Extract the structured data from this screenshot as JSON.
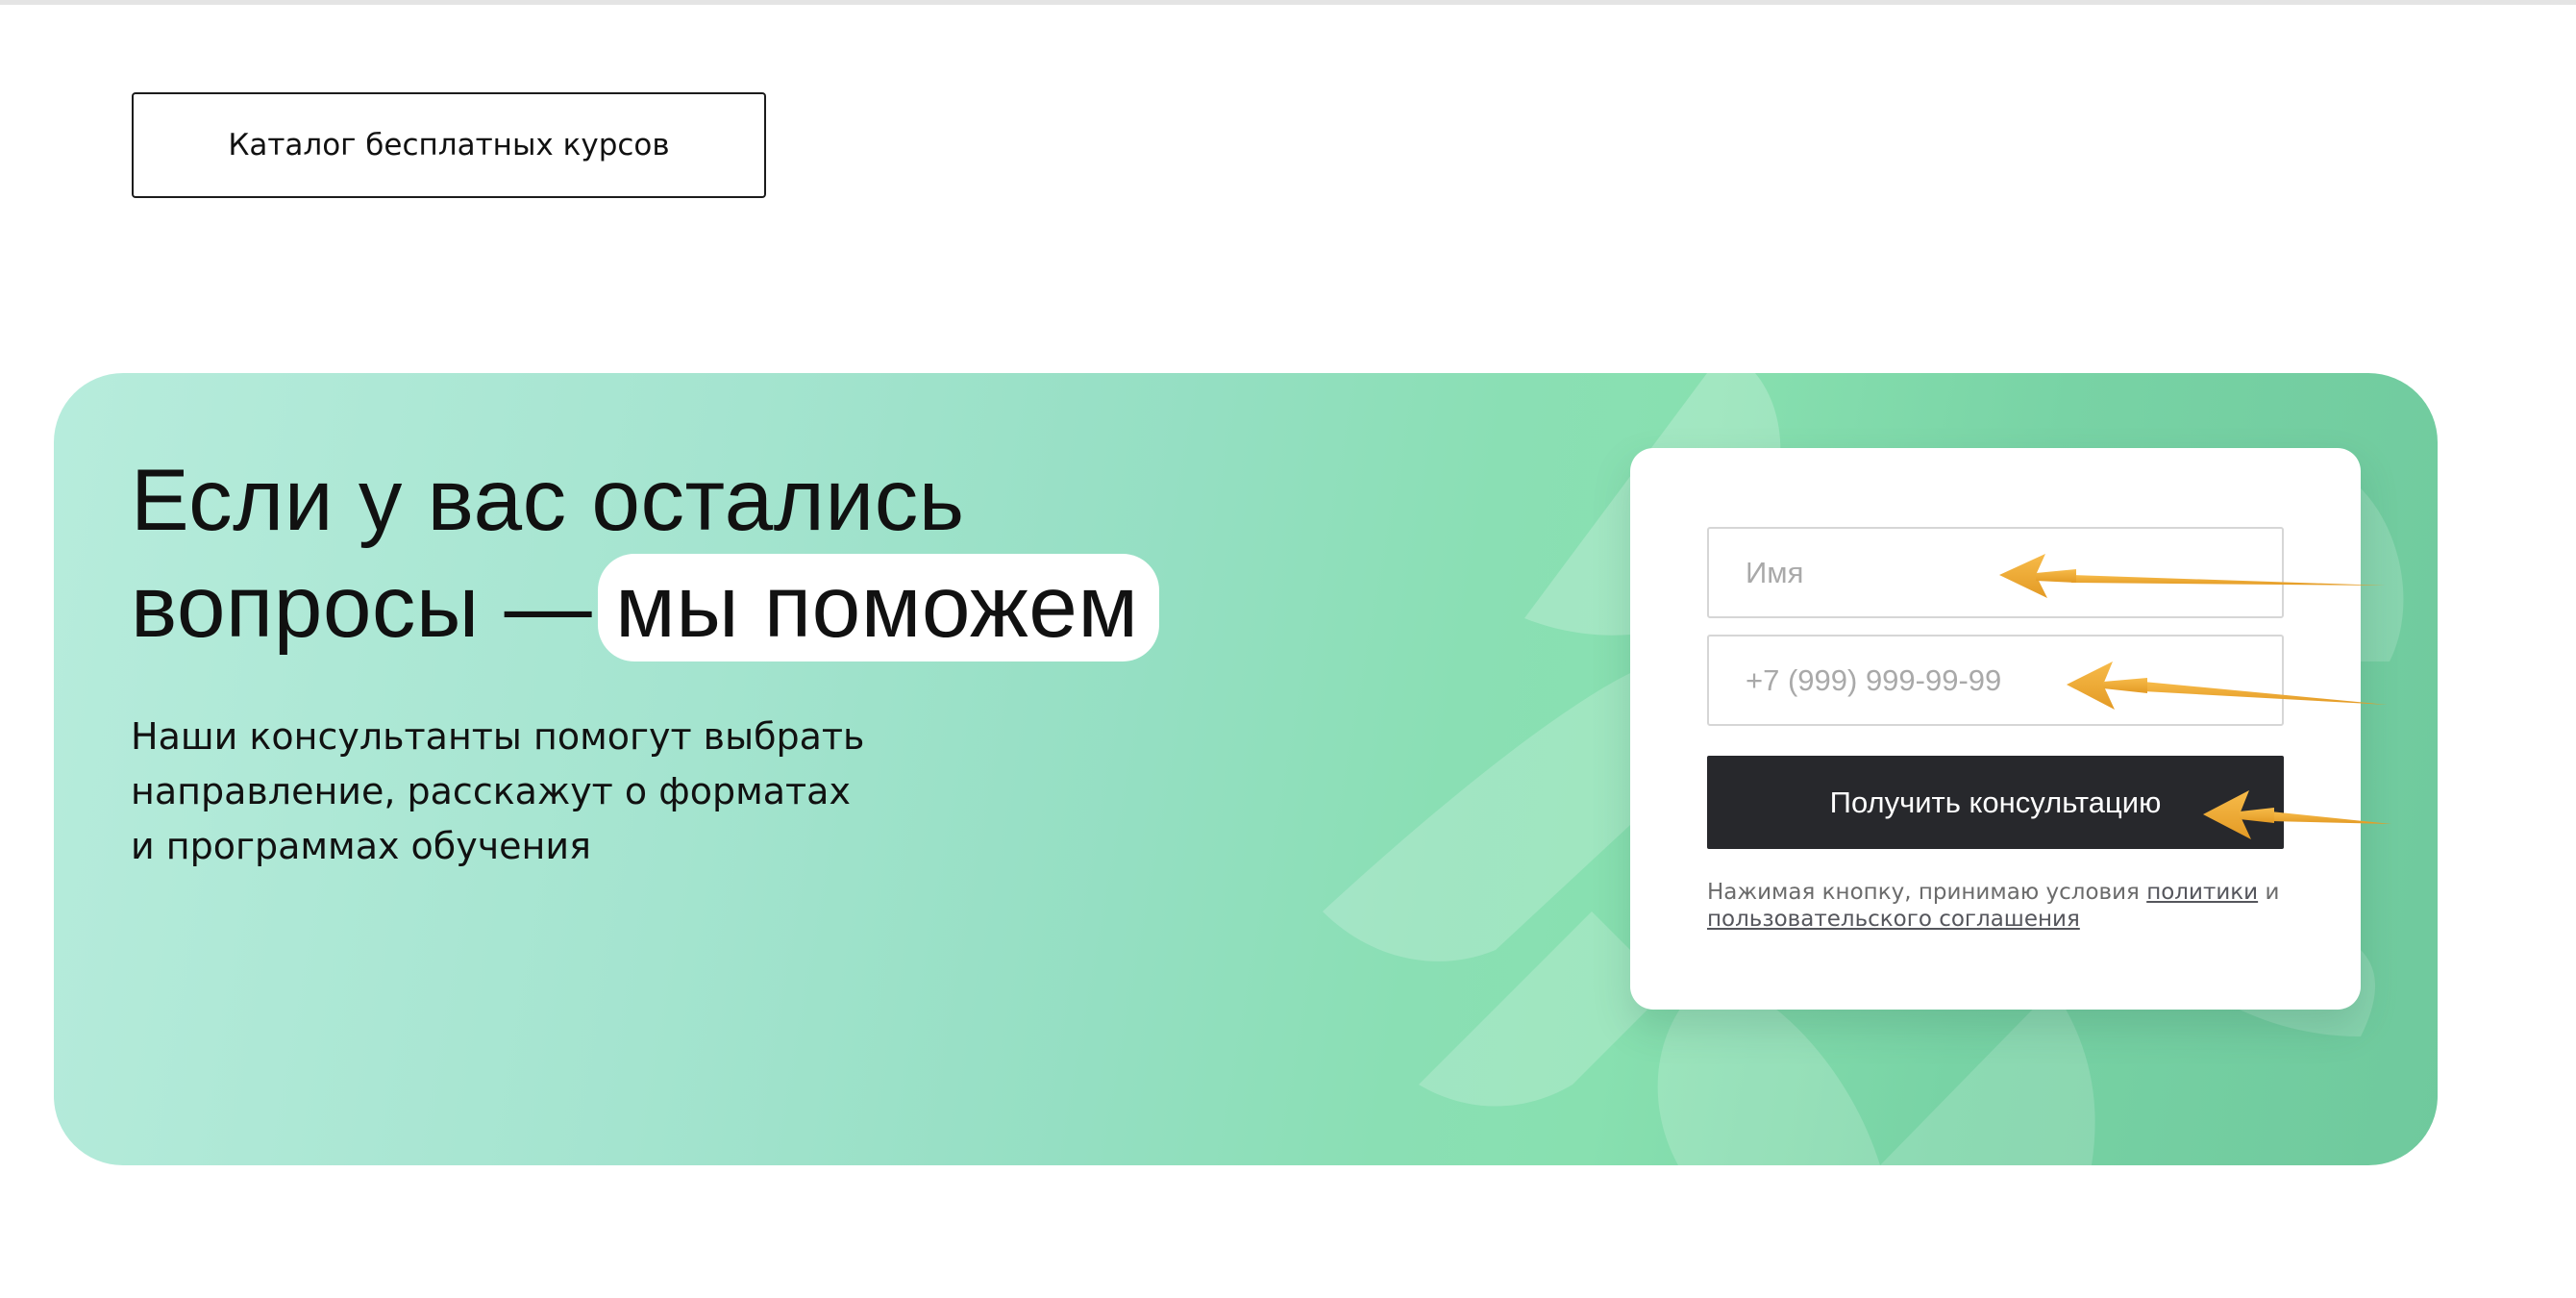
{
  "catalog": {
    "button_label": "Каталог бесплатных курсов"
  },
  "banner": {
    "headline_line1": "Если у вас остались",
    "headline_line2_prefix": "вопросы —",
    "headline_highlight": "мы поможем",
    "subtitle_lines": [
      "Наши консультанты помогут выбрать",
      "направление, расскажут о форматах",
      "и программах обучения"
    ]
  },
  "form": {
    "name_placeholder": "Имя",
    "phone_placeholder": "+7 (999) 999-99-99",
    "submit_label": "Получить консультацию",
    "consent": {
      "text_before": "Нажимая кнопку, принимаю условия",
      "policy_link": "политики",
      "conjunction": "и",
      "agreement_link": "пользовательского соглашения"
    }
  },
  "colors": {
    "banner_gradient_start": "#b7ecdc",
    "banner_gradient_end": "#6fc99d",
    "submit_button_bg": "#27282c",
    "annotation_arrow": "#f3a833"
  },
  "annotations": {
    "arrows": [
      "arrow-to-name-field",
      "arrow-to-phone-field",
      "arrow-to-submit-button"
    ]
  }
}
